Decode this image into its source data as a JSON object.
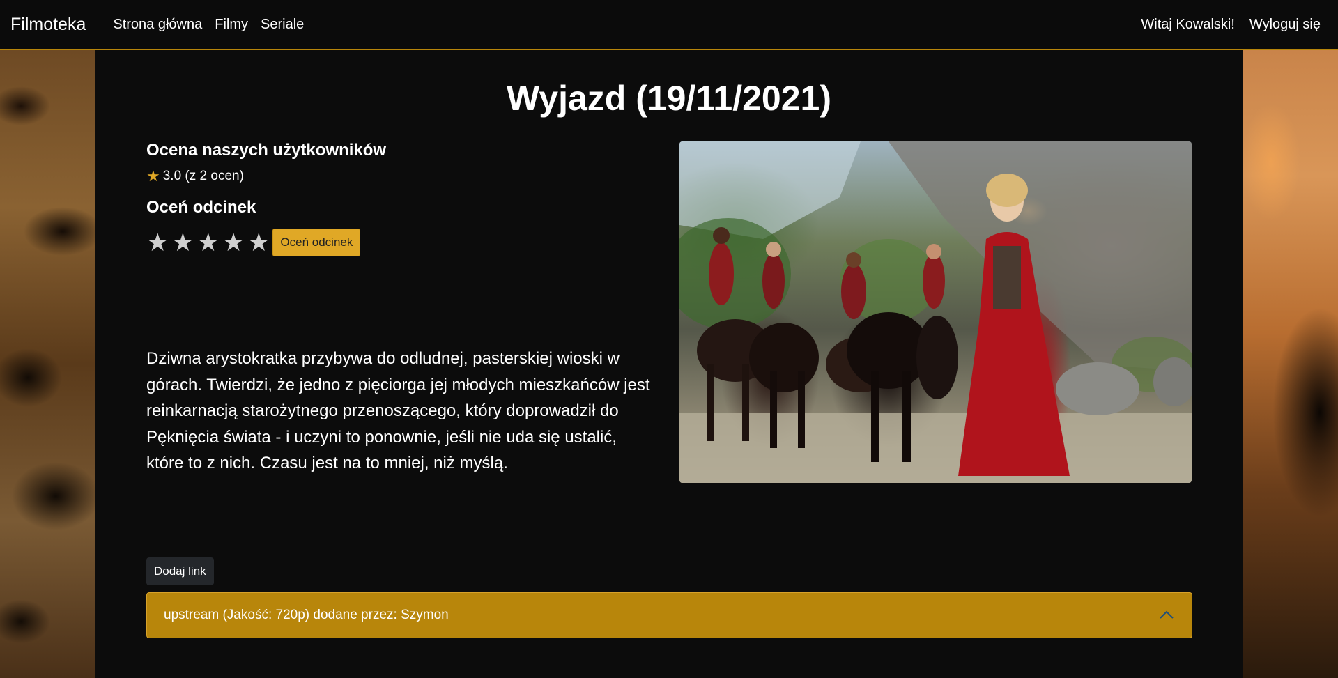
{
  "navbar": {
    "brand": "Filmoteka",
    "links": [
      {
        "label": "Strona główna"
      },
      {
        "label": "Filmy"
      },
      {
        "label": "Seriale"
      }
    ],
    "greeting": "Witaj Kowalski!",
    "logout": "Wyloguj się"
  },
  "episode": {
    "title": "Wyjazd (19/11/2021)",
    "user_rating_heading": "Ocena naszych użytkowników",
    "user_rating_text": "3.0 (z 2 ocen)",
    "rate_heading": "Oceń odcinek",
    "rate_stars": [
      {
        "icon": "star-icon",
        "value": 1
      },
      {
        "icon": "star-icon",
        "value": 2
      },
      {
        "icon": "star-icon",
        "value": 3
      },
      {
        "icon": "star-icon",
        "value": 4
      },
      {
        "icon": "star-icon",
        "value": 5
      }
    ],
    "rate_button": "Oceń odcinek",
    "description": "Dziwna arystokratka przybywa do odludnej, pasterskiej wioski w górach. Twierdzi, że jedno z pięciorga jej młodych mieszkańców jest reinkarnacją starożytnego przenoszącego, który doprowadził do Pęknięcia świata - i uczyni to ponownie, jeśli nie uda się ustalić, które to z nich. Czasu jest na to mniej, niż myślą."
  },
  "links": {
    "add_button": "Dodaj link",
    "items": [
      {
        "label": "upstream (Jakość: 720p) dodane przez: Szymon",
        "expanded": true
      }
    ]
  },
  "colors": {
    "accent": "#e0a826",
    "accordion": "#b8860b",
    "background": "#0c0c0c"
  }
}
